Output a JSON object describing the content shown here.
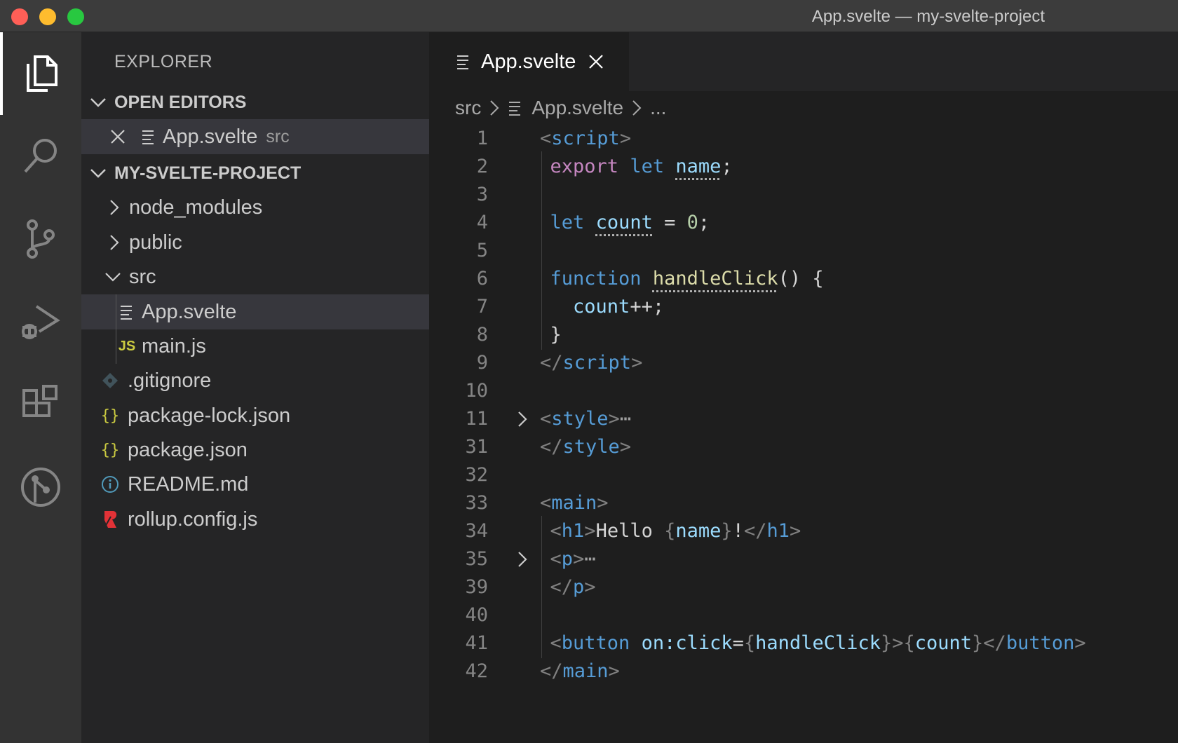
{
  "window": {
    "title": "App.svelte — my-svelte-project"
  },
  "activity_bar": {
    "items": [
      "explorer",
      "search",
      "source-control",
      "run-debug",
      "extensions",
      "git-graph"
    ]
  },
  "sidebar": {
    "title": "EXPLORER",
    "open_editors": {
      "label": "OPEN EDITORS",
      "items": [
        {
          "name": "App.svelte",
          "folder": "src"
        }
      ]
    },
    "project": {
      "label": "MY-SVELTE-PROJECT",
      "tree": [
        {
          "name": "node_modules",
          "type": "folder"
        },
        {
          "name": "public",
          "type": "folder"
        },
        {
          "name": "src",
          "type": "folder-open"
        },
        {
          "name": "App.svelte",
          "type": "svelte"
        },
        {
          "name": "main.js",
          "type": "js",
          "badge": "JS"
        },
        {
          "name": ".gitignore",
          "type": "git"
        },
        {
          "name": "package-lock.json",
          "type": "json",
          "badge": "{}"
        },
        {
          "name": "package.json",
          "type": "json",
          "badge": "{}"
        },
        {
          "name": "README.md",
          "type": "info"
        },
        {
          "name": "rollup.config.js",
          "type": "rollup"
        }
      ]
    }
  },
  "editor": {
    "tab": {
      "label": "App.svelte"
    },
    "breadcrumb": {
      "folder": "src",
      "file": "App.svelte",
      "more": "..."
    },
    "line_numbers": [
      "1",
      "2",
      "3",
      "4",
      "5",
      "6",
      "7",
      "8",
      "9",
      "10",
      "11",
      "31",
      "32",
      "33",
      "34",
      "35",
      "39",
      "40",
      "41",
      "42"
    ]
  },
  "colors": {
    "accent": "#007acc",
    "keyword": "#c586c0",
    "tag": "#569cd6",
    "variable": "#9cdcfe",
    "function": "#dcdcaa",
    "number": "#b5cea8"
  }
}
